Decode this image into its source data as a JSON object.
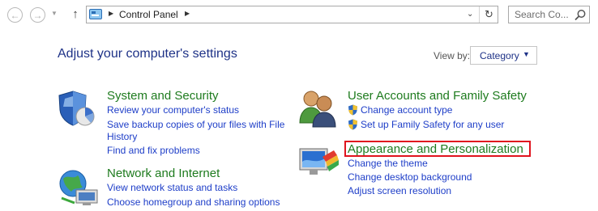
{
  "address_bar": {
    "breadcrumb": "Control Panel",
    "search_placeholder": "Search Co..."
  },
  "header": {
    "title": "Adjust your computer's settings",
    "view_by_label": "View by:",
    "view_by_value": "Category"
  },
  "categories": [
    {
      "title": "System and Security",
      "links": [
        "Review your computer's status",
        "Save backup copies of your files with File",
        "History",
        "Find and fix problems"
      ]
    },
    {
      "title": "Network and Internet",
      "links": [
        "View network status and tasks",
        "Choose homegroup and sharing options"
      ]
    },
    {
      "title": "User Accounts and Family Safety",
      "links": [
        "Change account type",
        "Set up Family Safety for any user"
      ]
    },
    {
      "title": "Appearance and Personalization",
      "links": [
        "Change the theme",
        "Change desktop background",
        "Adjust screen resolution"
      ]
    }
  ],
  "colors": {
    "category_title": "#1e7b1e",
    "link": "#1e3ec8",
    "page_title": "#1e3287",
    "highlight": "#e0141e"
  }
}
